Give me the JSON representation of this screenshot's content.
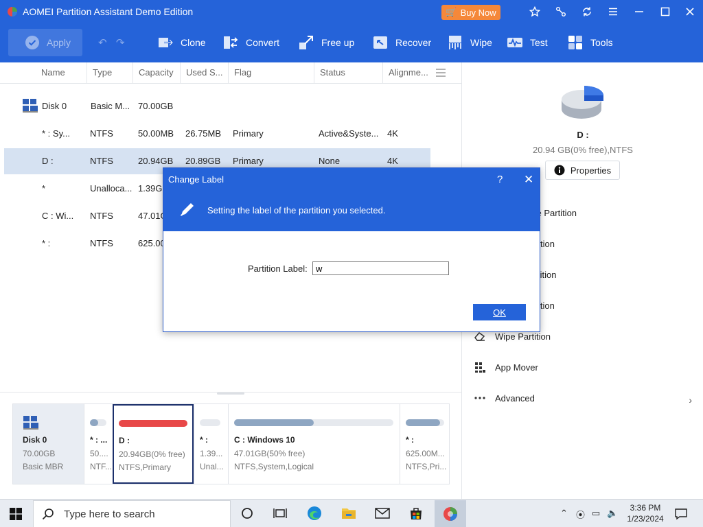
{
  "window": {
    "title": "AOMEI Partition Assistant Demo Edition",
    "buy_now": "Buy Now"
  },
  "toolbar": {
    "apply": "Apply",
    "tools": [
      {
        "label": "Clone",
        "icon": "clone-icon"
      },
      {
        "label": "Convert",
        "icon": "convert-icon"
      },
      {
        "label": "Free up",
        "icon": "free-up-icon"
      },
      {
        "label": "Recover",
        "icon": "recover-icon"
      },
      {
        "label": "Wipe",
        "icon": "wipe-icon"
      },
      {
        "label": "Test",
        "icon": "test-icon"
      },
      {
        "label": "Tools",
        "icon": "tools-icon"
      }
    ]
  },
  "columns": [
    "Name",
    "Type",
    "Capacity",
    "Used S...",
    "Flag",
    "Status",
    "Alignme..."
  ],
  "rows": [
    {
      "name": "Disk 0",
      "type": "Basic M...",
      "capacity": "70.00GB",
      "used": "",
      "flag": "",
      "status": "",
      "align": ""
    },
    {
      "name": "* : Sy...",
      "type": "NTFS",
      "capacity": "50.00MB",
      "used": "26.75MB",
      "flag": "Primary",
      "status": "Active&Syste...",
      "align": "4K"
    },
    {
      "name": "D :",
      "type": "NTFS",
      "capacity": "20.94GB",
      "used": "20.89GB",
      "flag": "Primary",
      "status": "None",
      "align": "4K"
    },
    {
      "name": "*",
      "type": "Unalloca...",
      "capacity": "1.39GE",
      "used": "",
      "flag": "",
      "status": "",
      "align": ""
    },
    {
      "name": "C : Wi...",
      "type": "NTFS",
      "capacity": "47.01G",
      "used": "",
      "flag": "",
      "status": "",
      "align": ""
    },
    {
      "name": "* :",
      "type": "NTFS",
      "capacity": "625.00",
      "used": "",
      "flag": "",
      "status": "",
      "align": ""
    }
  ],
  "right_panel": {
    "disk_name": "D :",
    "disk_info": "20.94 GB(0% free),NTFS",
    "properties": "Properties",
    "operations": [
      {
        "label": "ve Partition",
        "icon": ""
      },
      {
        "label": "tion",
        "icon": ""
      },
      {
        "label": "tition",
        "icon": ""
      },
      {
        "label": "ition",
        "icon": ""
      },
      {
        "label": "Wipe Partition",
        "icon": "eraser-icon"
      },
      {
        "label": "App Mover",
        "icon": "app-grid-icon"
      },
      {
        "label": "Advanced",
        "icon": "more-icon"
      }
    ]
  },
  "disk_map": {
    "disk": {
      "name": "Disk 0",
      "size": "70.00GB",
      "type": "Basic MBR"
    },
    "partitions": [
      {
        "name": "* : ...",
        "line1": "50....",
        "line2": "NTF...",
        "fill": 0.5
      },
      {
        "name": "D :",
        "line1": "20.94GB(0% free)",
        "line2": "NTFS,Primary",
        "fill": 1.0
      },
      {
        "name": "* :",
        "line1": "1.39...",
        "line2": "Unal...",
        "fill": 0
      },
      {
        "name": "C : Windows 10",
        "line1": "47.01GB(50% free)",
        "line2": "NTFS,System,Logical",
        "fill": 0.5
      },
      {
        "name": "* :",
        "line1": "625.00M...",
        "line2": "NTFS,Pri...",
        "fill": 0.9
      }
    ]
  },
  "dialog": {
    "title": "Change Label",
    "help": "?",
    "close": "✕",
    "description": "Setting the label of the partition you selected.",
    "field_label": "Partition Label:",
    "field_value": "w",
    "ok": "OK"
  },
  "taskbar": {
    "search_placeholder": "Type here to search",
    "time": "3:36 PM",
    "date": "1/23/2024"
  },
  "colors": {
    "accent": "#2563d9",
    "buy_now": "#f5883a",
    "selected_row": "#d6e2f2",
    "used_bar": "#8ea6c2",
    "full_bar": "#e84848"
  }
}
